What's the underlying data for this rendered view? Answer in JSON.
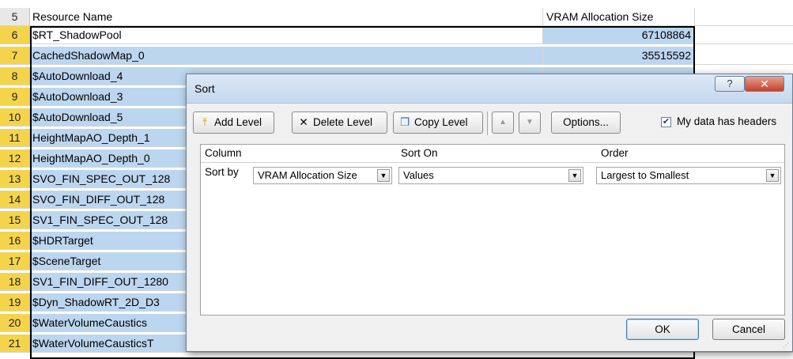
{
  "sheet": {
    "header_row": {
      "num": "5",
      "col_a": "Resource Name",
      "col_b": "VRAM Allocation Size"
    },
    "rows": [
      {
        "num": "6",
        "name": "$RT_ShadowPool",
        "size": "67108864"
      },
      {
        "num": "7",
        "name": "CachedShadowMap_0",
        "size": "35515592"
      },
      {
        "num": "8",
        "name": "$AutoDownload_4",
        "size": ""
      },
      {
        "num": "9",
        "name": "$AutoDownload_3",
        "size": ""
      },
      {
        "num": "10",
        "name": "$AutoDownload_5",
        "size": ""
      },
      {
        "num": "11",
        "name": "HeightMapAO_Depth_1",
        "size": ""
      },
      {
        "num": "12",
        "name": "HeightMapAO_Depth_0",
        "size": ""
      },
      {
        "num": "13",
        "name": "SVO_FIN_SPEC_OUT_128",
        "size": ""
      },
      {
        "num": "14",
        "name": "SVO_FIN_DIFF_OUT_128",
        "size": ""
      },
      {
        "num": "15",
        "name": "SV1_FIN_SPEC_OUT_128",
        "size": ""
      },
      {
        "num": "16",
        "name": "$HDRTarget",
        "size": ""
      },
      {
        "num": "17",
        "name": "$SceneTarget",
        "size": ""
      },
      {
        "num": "18",
        "name": "SV1_FIN_DIFF_OUT_1280",
        "size": ""
      },
      {
        "num": "19",
        "name": "$Dyn_ShadowRT_2D_D3",
        "size": ""
      },
      {
        "num": "20",
        "name": "$WaterVolumeCaustics",
        "size": ""
      },
      {
        "num": "21",
        "name": "$WaterVolumeCausticsT",
        "size": ""
      }
    ]
  },
  "dialog": {
    "title": "Sort",
    "help_label": "?",
    "close_label": "✕",
    "toolbar": {
      "add_level": "Add Level",
      "delete_level": "Delete Level",
      "copy_level": "Copy Level",
      "move_up": "▲",
      "move_down": "▼",
      "options": "Options...",
      "headers_check": "✔",
      "headers_label": "My data has headers"
    },
    "columns": {
      "column": "Column",
      "sort_on": "Sort On",
      "order": "Order"
    },
    "level": {
      "label": "Sort by",
      "column_value": "VRAM Allocation Size",
      "sort_on_value": "Values",
      "order_value": "Largest to Smallest"
    },
    "ok": "OK",
    "cancel": "Cancel"
  }
}
